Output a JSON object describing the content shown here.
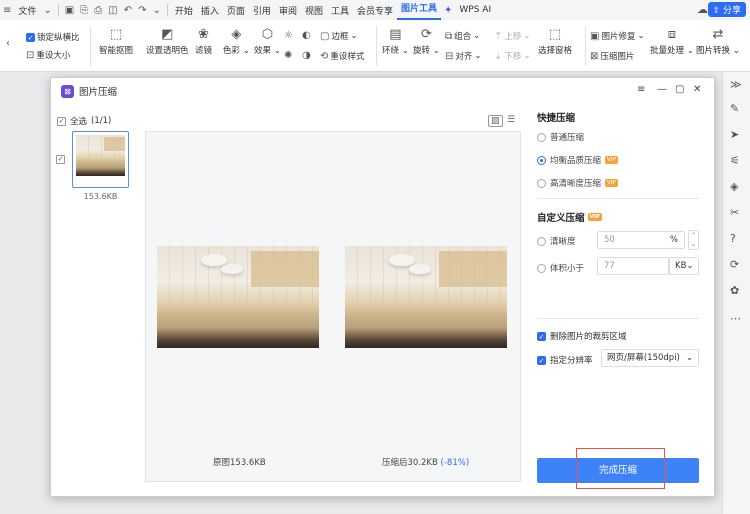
{
  "menubar": {
    "file": "文件",
    "items": [
      "开始",
      "插入",
      "页面",
      "引用",
      "审阅",
      "视图",
      "工具",
      "会员专享"
    ],
    "active_tab": "图片工具",
    "wps_ai": "WPS AI",
    "share": "分享"
  },
  "ribbon": {
    "lock_ratio": "锁定纵横比",
    "reset_size": "重设大小",
    "smart_cutout": "智能抠图",
    "set_transparent": "设置透明色",
    "filter": "滤镜",
    "color": "色彩",
    "effects": "效果",
    "border": "边框",
    "reset_style": "重设样式",
    "wrap": "环绕",
    "rotate": "旋转",
    "group": "组合",
    "align": "对齐",
    "bring_forward": "上移",
    "send_backward": "下移",
    "selection_pane": "选择窗格",
    "image_repair": "图片修复",
    "compress_image": "压缩图片",
    "batch_process": "批量处理",
    "image_convert": "图片转换"
  },
  "dialog": {
    "title": "图片压缩",
    "select_all": "全选",
    "count": "(1/1)",
    "thumb_size": "153.6KB",
    "original_caption": "原图153.6KB",
    "compressed_caption": "压缩后30.2KB",
    "compressed_pct": "(-81%)",
    "quick_heading": "快捷压缩",
    "quick_options": [
      {
        "label": "普通压缩",
        "vip": false,
        "selected": false
      },
      {
        "label": "均衡品质压缩",
        "vip": true,
        "selected": true
      },
      {
        "label": "高清晰度压缩",
        "vip": true,
        "selected": false
      }
    ],
    "custom_heading": "自定义压缩",
    "vip_badge": "VIP",
    "clarity_label": "清晰度",
    "clarity_value": "50",
    "clarity_unit": "%",
    "size_label": "体积小于",
    "size_value": "77",
    "size_unit": "KB",
    "delete_crop": "删除图片的裁剪区域",
    "resolution_label": "指定分辨率",
    "resolution_value": "网页/屏幕(150dpi)",
    "finish_button": "完成压缩"
  }
}
